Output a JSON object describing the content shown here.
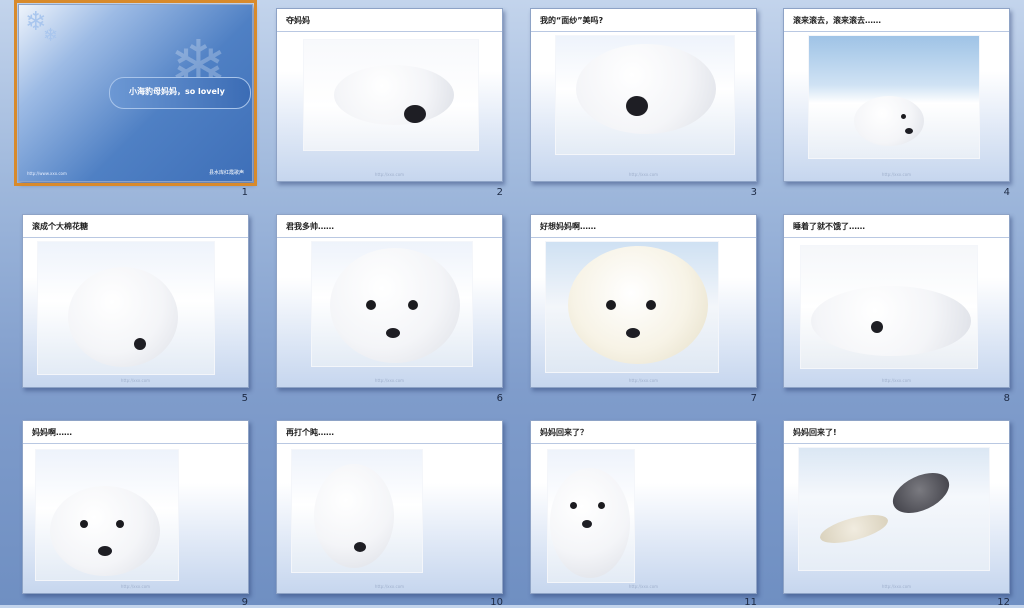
{
  "slides": [
    {
      "number": "1",
      "title": "小海豹母妈妈，so lovely",
      "footer_left": "http://www.xxx.com",
      "footer_right": "县水库红霞歌声",
      "selected": true
    },
    {
      "number": "2",
      "title": "夺妈妈"
    },
    {
      "number": "3",
      "title": "我的“面纱”美吗?"
    },
    {
      "number": "4",
      "title": "滚来滚去，滚来滚去……"
    },
    {
      "number": "5",
      "title": "滚成个大棉花糖"
    },
    {
      "number": "6",
      "title": "君我多帅……"
    },
    {
      "number": "7",
      "title": "好想妈妈啊……"
    },
    {
      "number": "8",
      "title": "睡着了就不饿了……"
    },
    {
      "number": "9",
      "title": "妈妈啊……"
    },
    {
      "number": "10",
      "title": "再打个盹……"
    },
    {
      "number": "11",
      "title": "妈妈回来了？"
    },
    {
      "number": "12",
      "title": "妈妈回来了!"
    }
  ],
  "slide_footer": "http://xxx.com",
  "colors": {
    "selection": "#d88a2b",
    "background": "#8fa9d3",
    "slide1_blue": "#3e6fb8"
  },
  "icons": {
    "slide1_decoration": "snowflake-icon"
  }
}
